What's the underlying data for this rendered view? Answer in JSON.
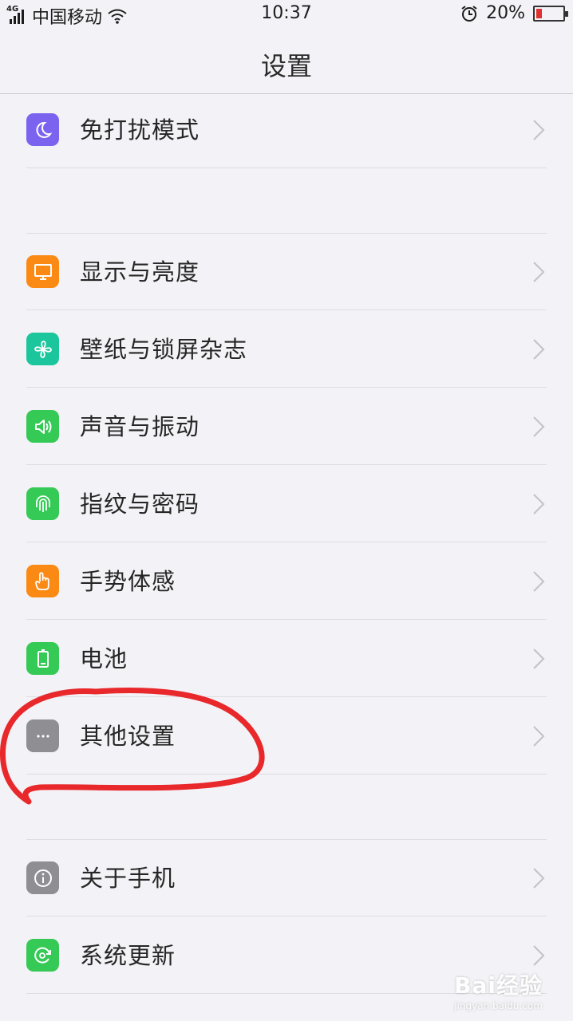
{
  "status_bar": {
    "network": "4G",
    "carrier": "中国移动",
    "time": "10:37",
    "battery_percent": "20%",
    "battery_level": 0.2,
    "icons": [
      "signal-icon",
      "wifi-icon",
      "alarm-icon",
      "battery-icon"
    ]
  },
  "nav": {
    "title": "设置"
  },
  "items": [
    {
      "label": "免打扰模式",
      "icon": "moon-icon",
      "color": "#7b63f0"
    },
    {
      "label": "显示与亮度",
      "icon": "monitor-icon",
      "color": "#fb8a14"
    },
    {
      "label": "壁纸与锁屏杂志",
      "icon": "pinwheel-icon",
      "color": "#1bc69c"
    },
    {
      "label": "声音与振动",
      "icon": "speaker-icon",
      "color": "#35c956"
    },
    {
      "label": "指纹与密码",
      "icon": "fingerprint-icon",
      "color": "#35c956"
    },
    {
      "label": "手势体感",
      "icon": "hand-icon",
      "color": "#fb8a14"
    },
    {
      "label": "电池",
      "icon": "battery-icon",
      "color": "#35c956"
    },
    {
      "label": "其他设置",
      "icon": "more-icon",
      "color": "#8e8e93"
    },
    {
      "label": "关于手机",
      "icon": "info-icon",
      "color": "#8e8e93"
    },
    {
      "label": "系统更新",
      "icon": "update-icon",
      "color": "#35c956"
    }
  ],
  "annotation": {
    "color": "#e8282b"
  },
  "watermark": {
    "main": "Bai经验",
    "sub": "jingyan.baidu.com"
  }
}
